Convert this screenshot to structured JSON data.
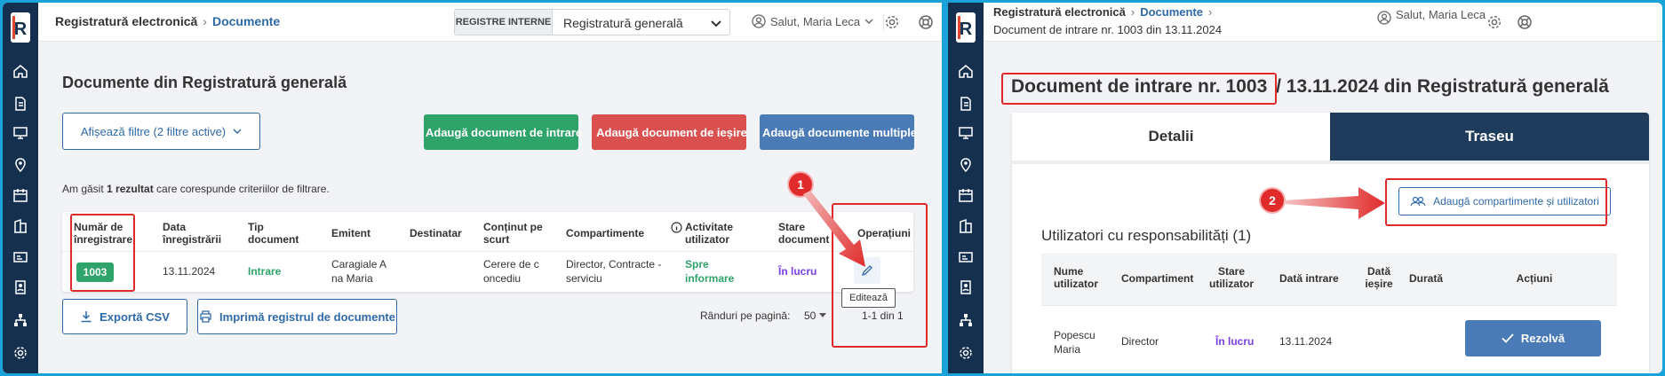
{
  "colors": {
    "rail": "#15304f",
    "link": "#2f6aa8",
    "green": "#2ea36a",
    "red": "#d9504f",
    "blue": "#4a7bb7",
    "annotation": "#e02a2a",
    "status_purple": "#7b3fe4",
    "dark_tab": "#1f3b5c"
  },
  "rail_icons": [
    "logo-icon",
    "home-icon",
    "document-icon",
    "monitor-icon",
    "location-icon",
    "calendar-icon",
    "building-icon",
    "card-icon",
    "user-badge-icon",
    "org-chart-icon",
    "settings-icon"
  ],
  "left": {
    "breadcrumb": {
      "root": "Registratură electronică",
      "current": "Documente"
    },
    "registry_select": {
      "label": "REGISTRE INTERNE",
      "value": "Registratură generală"
    },
    "user": "Salut, Maria Leca",
    "page_title": "Documente din Registratură generală",
    "filters_button": "Afișează filtre (2 filtre active)",
    "actions": {
      "add_in": "Adaugă document de intrare",
      "add_out": "Adaugă document de ieșire",
      "add_multi": "Adaugă documente multiple"
    },
    "result": {
      "pre": "Am găsit ",
      "count": "1 rezultat",
      "post": " care corespunde criteriilor de filtrare."
    },
    "table": {
      "headers": [
        "Număr de înregistrare",
        "Data înregistrării",
        "Tip document",
        "Emitent",
        "Destinatar",
        "Conținut pe scurt",
        "Compartimente",
        "Activitate utilizator",
        "Stare document",
        "Operațiuni"
      ],
      "row": {
        "number": "1003",
        "date": "13.11.2024",
        "type": "Intrare",
        "issuer": "Caragiale A na Maria",
        "recipient": "",
        "content": "Cerere de c oncediu",
        "departments": "Director, Contracte - serviciu",
        "activity": "Spre informare",
        "status": "În lucru"
      }
    },
    "tooltip": "Editează",
    "export_csv": "Exportă CSV",
    "print": "Imprimă registrul de documente",
    "rows_per_page": {
      "label": "Rânduri pe pagină:",
      "value": "50"
    },
    "pagination": "1-1 din 1",
    "callout": "1"
  },
  "right": {
    "breadcrumb": {
      "root": "Registratură electronică",
      "current": "Documente"
    },
    "subtitle": "Document de intrare nr. 1003 din 13.11.2024",
    "user": "Salut, Maria Leca",
    "title_boxed": "Document de intrare nr. 1003",
    "title_rest": "/ 13.11.2024 din Registratură generală",
    "tabs": [
      "Detalii",
      "Traseu"
    ],
    "add_button": "Adaugă compartimente și utilizatori",
    "section_title": "Utilizatori cu responsabilități (1)",
    "table": {
      "headers": [
        "Nume utilizator",
        "Compartiment",
        "Stare utilizator",
        "Dată intrare",
        "Dată ieșire",
        "Durată",
        "Acțiuni"
      ],
      "row": {
        "name": "Popescu Maria",
        "department": "Director",
        "status": "În lucru",
        "date_in": "13.11.2024",
        "date_out": "",
        "duration": "",
        "action": "Rezolvă"
      }
    },
    "callout": "2"
  }
}
